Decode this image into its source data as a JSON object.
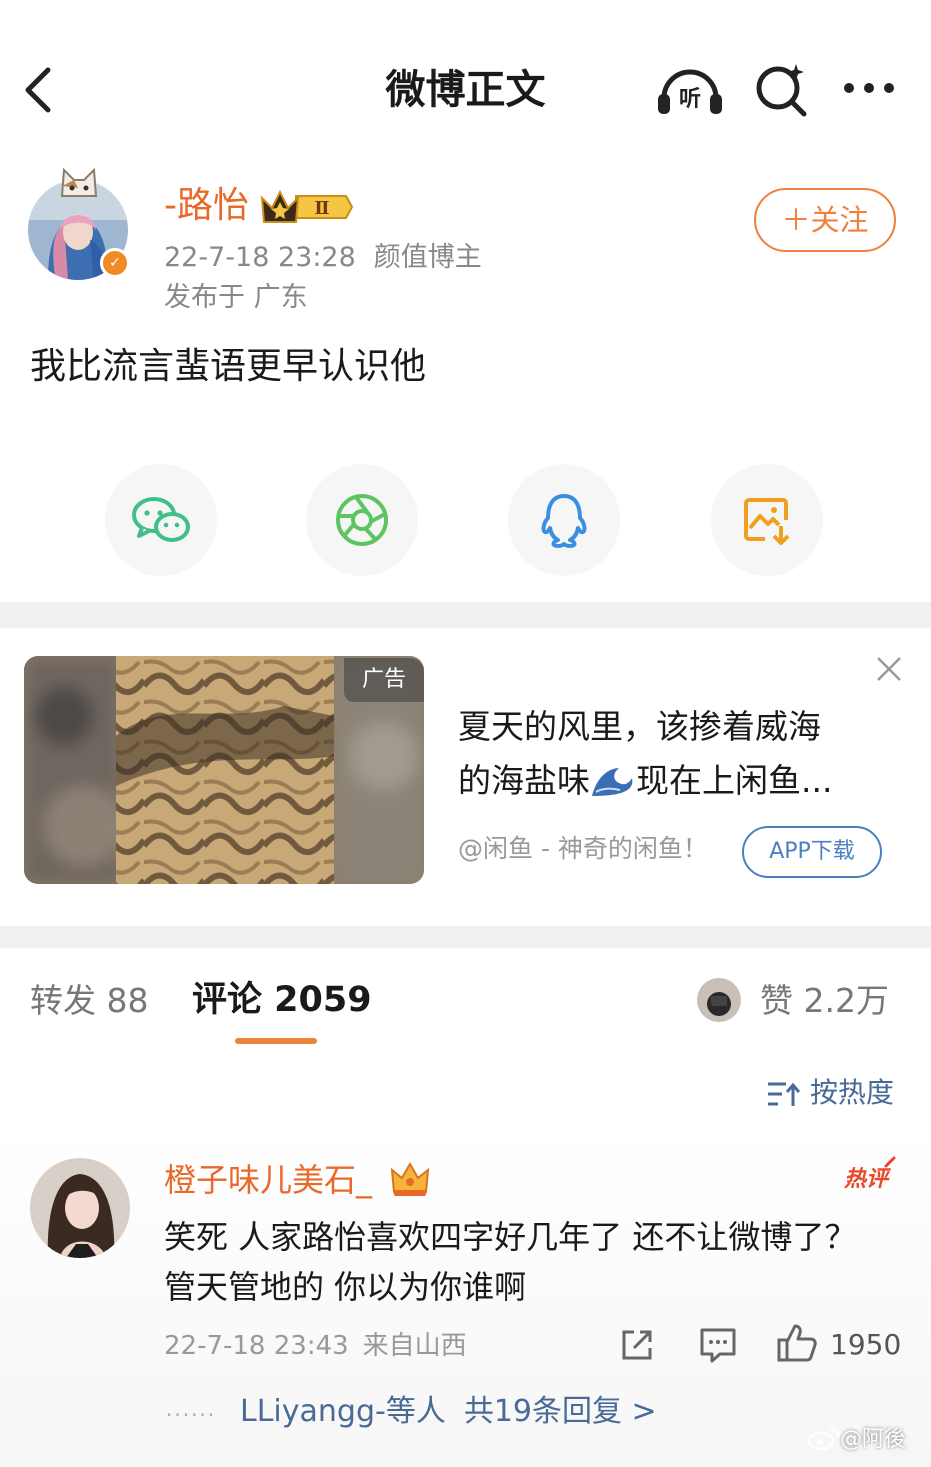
{
  "header": {
    "title": "微博正文"
  },
  "author": {
    "name": "-路怡",
    "date": "22-7-18 23:28",
    "tag": "颜值博主",
    "location": "发布于 广东",
    "follow_label": "＋关注",
    "vip_level": "Ⅱ"
  },
  "post": {
    "text": "我比流言蜚语更早认识他"
  },
  "share": {
    "items": [
      "wechat-icon",
      "moments-icon",
      "qq-icon",
      "save-image-icon"
    ],
    "colors": {
      "wechat": "#3fbf8a",
      "moments": "#5cc560",
      "qq": "#3a8fe0",
      "save": "#f0a020"
    }
  },
  "ad": {
    "tag": "广告",
    "title_line1": "夏天的风里，该掺着威海",
    "title_line2_a": "的海盐味",
    "title_line2_b": "现在上闲鱼...",
    "source": "@闲鱼 - 神奇的闲鱼！",
    "download_label": "APP下载"
  },
  "tabs": {
    "repost_label": "转发 88",
    "comment_label": "评论 2059",
    "like_label": "赞 2.2万"
  },
  "sort": {
    "label": "按热度"
  },
  "comment": {
    "name": "橙子味儿美石_",
    "hot_label": "热评",
    "text": "笑死 人家路怡喜欢四字好几年了 还不让微博了？管天管地的 你以为你谁啊",
    "date": "22-7-18 23:43",
    "source": "来自山西",
    "likes": "1950",
    "dots": "......",
    "reply_users": "LLiyangg-等人",
    "reply_count": "共19条回复 >"
  },
  "watermark": "@阿後",
  "colors": {
    "accent_orange": "#f0813a",
    "name_orange": "#e8692a",
    "link_blue": "#4a6a96"
  }
}
